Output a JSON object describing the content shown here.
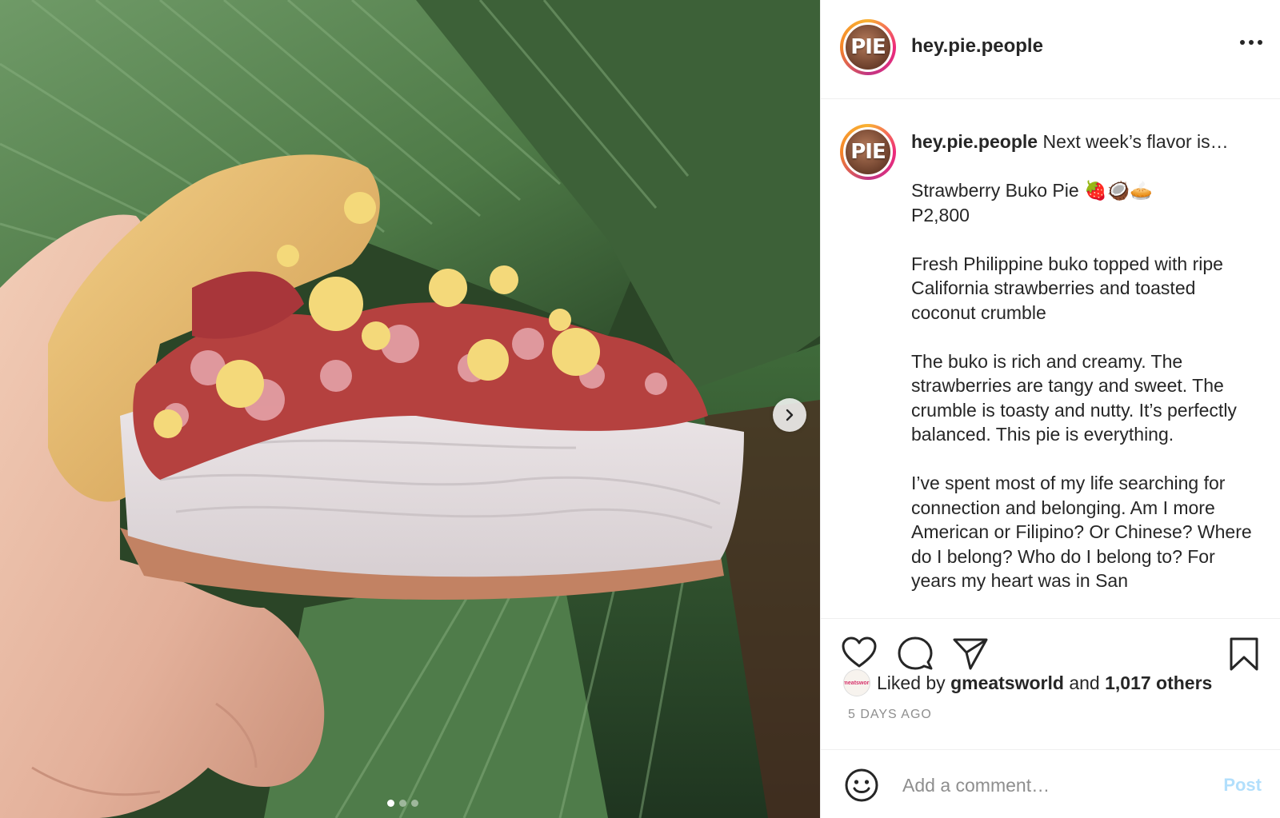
{
  "post": {
    "username": "hey.pie.people",
    "avatar_text": "PIE",
    "carousel": {
      "slide_count": 3,
      "active_index": 0
    }
  },
  "caption": {
    "username": "hey.pie.people",
    "lines": [
      "Next week’s flavor is…",
      "",
      "Strawberry Buko Pie 🍓🥥🥧",
      "P2,800",
      "",
      "Fresh Philippine buko topped with ripe California strawberries and toasted coconut crumble",
      "",
      "The buko is rich and creamy. The strawberries are tangy and sweet. The crumble is toasty and nutty. It’s perfectly balanced. This pie is everything.",
      "",
      "I’ve spent most of my life searching for connection and belonging. Am I more American or Filipino? Or Chinese? Where do I belong? Who do I belong to? For years my heart was in San"
    ]
  },
  "likes": {
    "prefix": "Liked by",
    "first_user": "gmeatsworld",
    "conjunction": "and",
    "others": "1,017 others",
    "liker_avatar_text": "gmeatsworld"
  },
  "timestamp": "5 DAYS AGO",
  "comment": {
    "placeholder": "Add a comment…",
    "post_label": "Post"
  },
  "icons": [
    "heart-icon",
    "comment-icon",
    "share-icon",
    "bookmark-icon",
    "emoji-icon",
    "more-icon",
    "chevron-right-icon"
  ],
  "colors": {
    "text": "#262626",
    "muted": "#8e8e8e",
    "post_button_disabled": "#b2dffc",
    "border": "#efefef"
  }
}
